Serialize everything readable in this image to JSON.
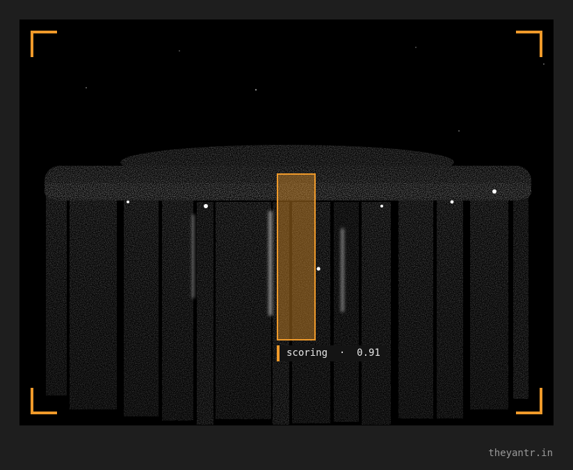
{
  "viewer": {
    "image_subject": "3d-point-cloud-render",
    "accent_color": "#f09a2a",
    "background_color": "#1e1e1e"
  },
  "detection": {
    "label": "scoring",
    "separator": "·",
    "confidence": "0.91"
  },
  "watermark": {
    "text": "theyantr.in"
  }
}
